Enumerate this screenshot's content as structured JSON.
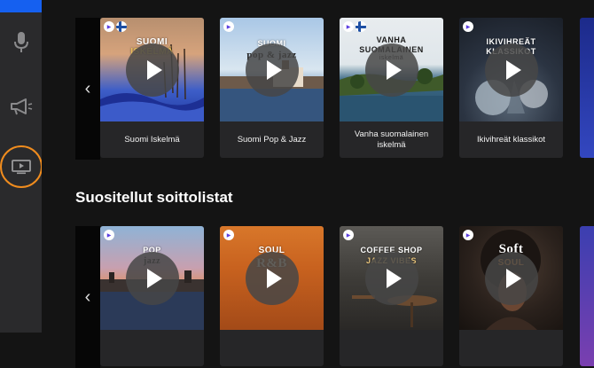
{
  "sidebar": {
    "items": [
      {
        "name": "microphone-icon"
      },
      {
        "name": "megaphone-icon"
      },
      {
        "name": "tv-icon"
      }
    ],
    "accent": "#1560f0",
    "active_ring": "#f08c1e"
  },
  "prev_glyph": "‹",
  "rows": [
    {
      "cards": [
        {
          "art_lines": [
            "SUOMI",
            "ISKELMÄ"
          ],
          "label": "Suomi Iskelmä"
        },
        {
          "art_lines": [
            "SUOMI",
            "pop & jazz"
          ],
          "label": "Suomi Pop & Jazz"
        },
        {
          "art_lines": [
            "VANHA",
            "SUOMALAINEN",
            "iskelmä"
          ],
          "label": "Vanha suomalainen iskelmä"
        },
        {
          "art_lines": [
            "IKIVIHREÄT",
            "KLASSIKOT"
          ],
          "label": "Ikivihreät klassikot"
        }
      ]
    },
    {
      "cards": [
        {
          "art_lines": [
            "POP",
            "jazz"
          ]
        },
        {
          "art_lines": [
            "SOUL",
            "R&B"
          ]
        },
        {
          "art_lines": [
            "COFFEE SHOP",
            "JAZZ VIBES"
          ]
        },
        {
          "art_lines": [
            "Soft",
            "SOUL"
          ]
        }
      ]
    }
  ],
  "section_title": "Suositellut soittolistat"
}
